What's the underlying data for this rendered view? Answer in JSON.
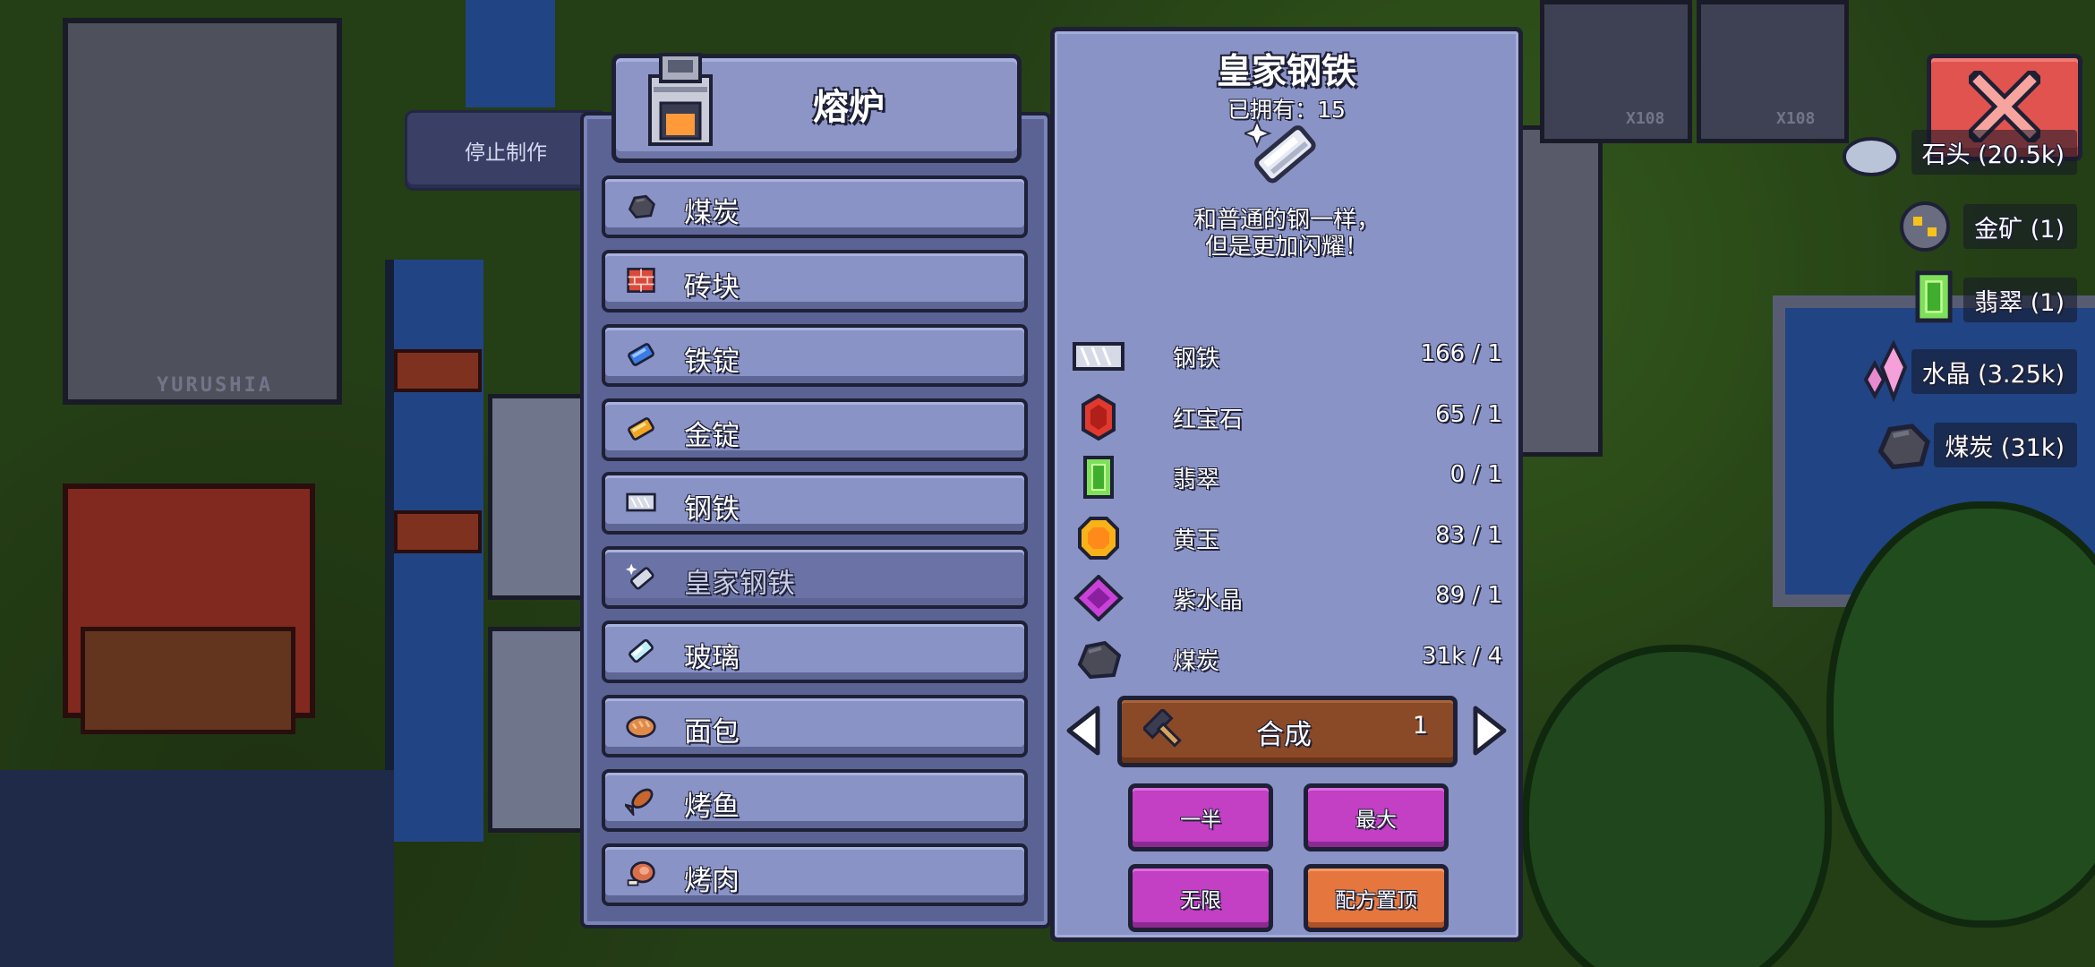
{
  "world": {
    "sign_text": "YURUSHIA",
    "shop_labels": [
      "X108",
      "X108"
    ]
  },
  "stop_button": {
    "label": "停止制作"
  },
  "furnace": {
    "title": "熔炉",
    "items": [
      {
        "label": "煤炭",
        "icon": "coal-icon"
      },
      {
        "label": "砖块",
        "icon": "brick-icon"
      },
      {
        "label": "铁锭",
        "icon": "iron-ingot-icon"
      },
      {
        "label": "金锭",
        "icon": "gold-ingot-icon"
      },
      {
        "label": "钢铁",
        "icon": "steel-icon"
      },
      {
        "label": "皇家钢铁",
        "icon": "royal-steel-icon",
        "selected": true
      },
      {
        "label": "玻璃",
        "icon": "glass-icon"
      },
      {
        "label": "面包",
        "icon": "bread-icon"
      },
      {
        "label": "烤鱼",
        "icon": "cooked-fish-icon"
      },
      {
        "label": "烤肉",
        "icon": "cooked-meat-icon"
      }
    ]
  },
  "detail": {
    "title": "皇家钢铁",
    "owned": "已拥有：15",
    "description_line1": "和普通的钢一样，",
    "description_line2": "但是更加闪耀！",
    "ingredients": [
      {
        "name": "钢铁",
        "qty": "166 / 1",
        "icon": "steel-icon"
      },
      {
        "name": "红宝石",
        "qty": "65 / 1",
        "icon": "ruby-icon"
      },
      {
        "name": "翡翠",
        "qty": "0 / 1",
        "icon": "emerald-icon"
      },
      {
        "name": "黄玉",
        "qty": "83 / 1",
        "icon": "topaz-icon"
      },
      {
        "name": "紫水晶",
        "qty": "89 / 1",
        "icon": "amethyst-icon"
      },
      {
        "name": "煤炭",
        "qty": "31k / 4",
        "icon": "coal-icon"
      }
    ],
    "craft_label": "合成",
    "craft_count": "1",
    "buttons": {
      "half": "一半",
      "max": "最大",
      "infinite": "无限",
      "pin_recipe": "配方置顶"
    }
  },
  "resources": [
    {
      "label": "石头 (20.5k)",
      "icon": "stone-icon"
    },
    {
      "label": "金矿 (1)",
      "icon": "gold-ore-icon"
    },
    {
      "label": "翡翠 (1)",
      "icon": "emerald-icon"
    },
    {
      "label": "水晶 (3.25k)",
      "icon": "crystal-icon"
    },
    {
      "label": "煤炭 (31k)",
      "icon": "coal-icon"
    }
  ],
  "colors": {
    "panel": "#8a93c6",
    "panel_dark": "#5a6394",
    "outline": "#1e2036",
    "craft": "#8a4a27",
    "purple_button": "#c33fc4",
    "orange_button": "#e5763e",
    "close": "#e0534e"
  }
}
